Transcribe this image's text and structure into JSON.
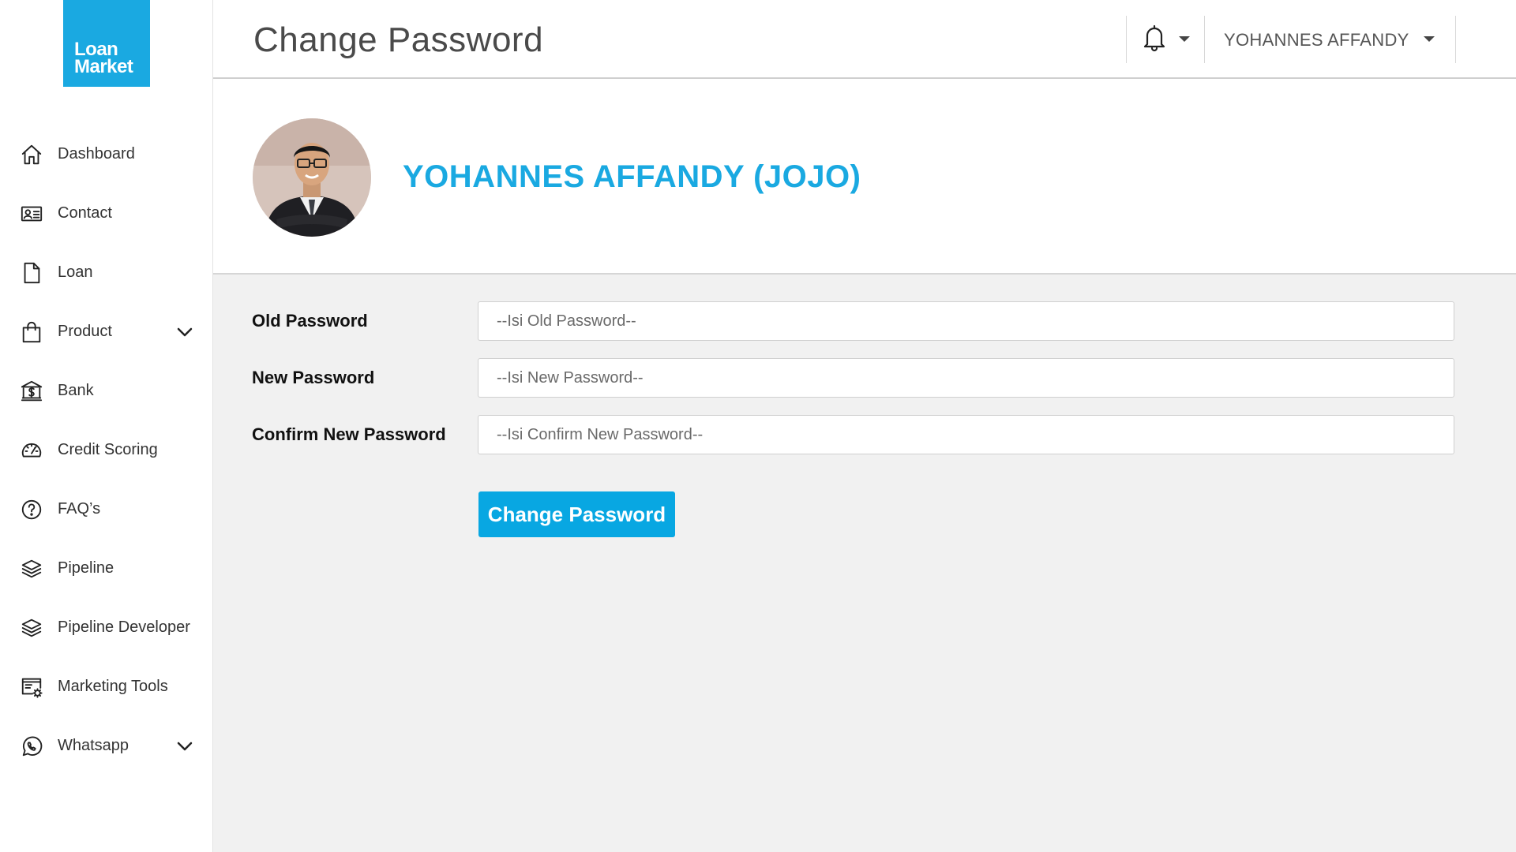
{
  "brand": {
    "logo_line1": "Loan",
    "logo_line2": "Market",
    "color": "#1aa9e1"
  },
  "sidebar": {
    "items": [
      {
        "label": "Dashboard",
        "icon": "home-icon"
      },
      {
        "label": "Contact",
        "icon": "contact-card-icon"
      },
      {
        "label": "Loan",
        "icon": "document-icon"
      },
      {
        "label": "Product",
        "icon": "shopping-bag-icon",
        "has_submenu": true
      },
      {
        "label": "Bank",
        "icon": "bank-icon"
      },
      {
        "label": "Credit Scoring",
        "icon": "gauge-icon"
      },
      {
        "label": "FAQ’s",
        "icon": "question-circle-icon"
      },
      {
        "label": "Pipeline",
        "icon": "layers-icon"
      },
      {
        "label": "Pipeline Developer",
        "icon": "layers-icon"
      },
      {
        "label": "Marketing Tools",
        "icon": "monitor-gear-icon"
      },
      {
        "label": "Whatsapp",
        "icon": "whatsapp-icon",
        "has_submenu": true
      }
    ]
  },
  "header": {
    "title": "Change Password",
    "user_name": "YOHANNES AFFANDY",
    "notification_icon": "bell-icon"
  },
  "profile": {
    "display_name": "YOHANNES AFFANDY (JOJO)",
    "name_color": "#1aa9e1"
  },
  "form": {
    "old_password": {
      "label": "Old Password",
      "placeholder": "--Isi Old Password--",
      "value": ""
    },
    "new_password": {
      "label": "New Password",
      "placeholder": "--Isi New Password--",
      "value": ""
    },
    "confirm_password": {
      "label": "Confirm New Password",
      "placeholder": "--Isi Confirm New Password--",
      "value": ""
    },
    "submit_label": "Change Password",
    "submit_color": "#08a7e2"
  }
}
